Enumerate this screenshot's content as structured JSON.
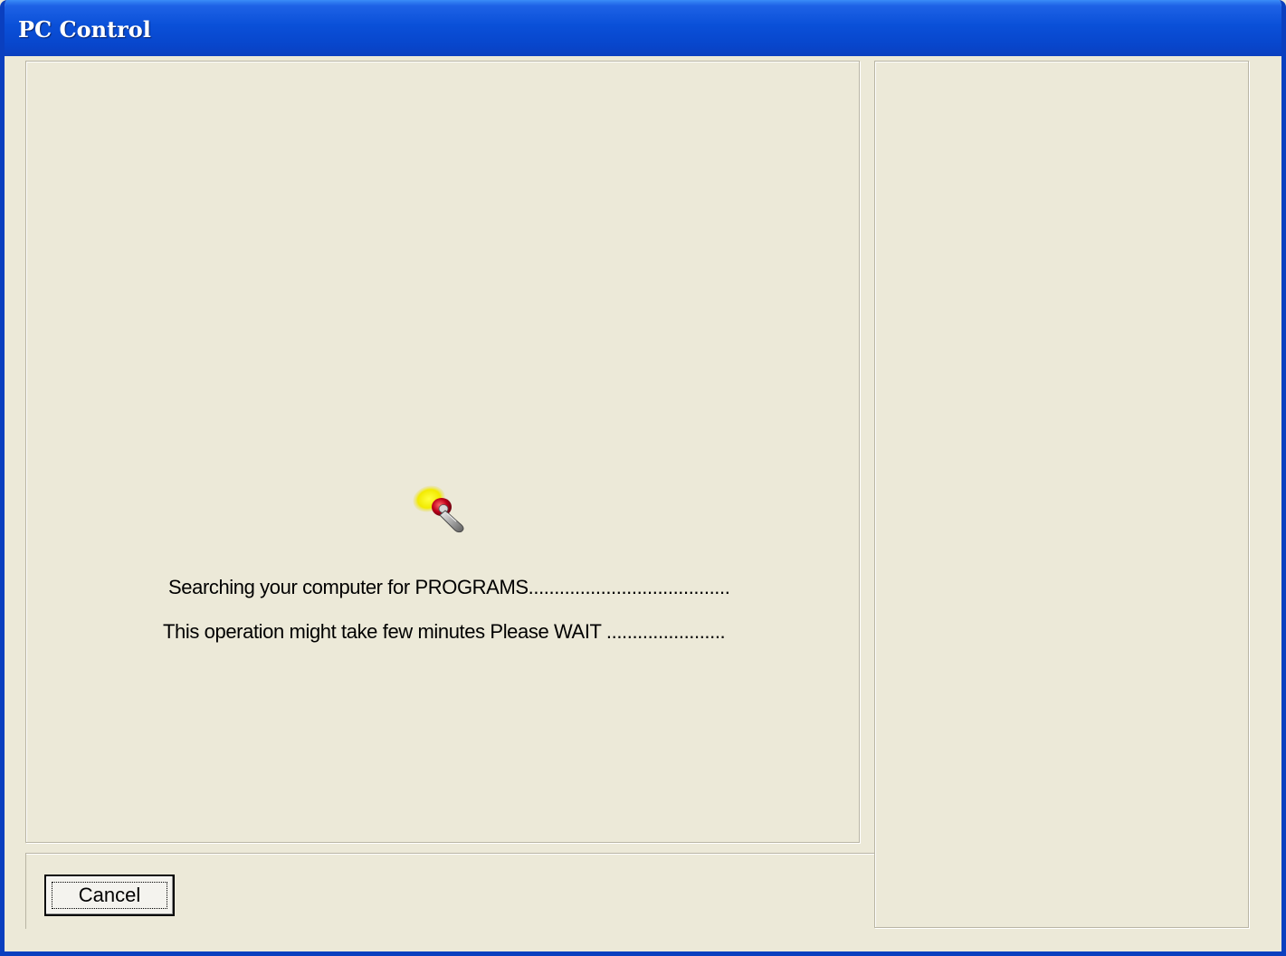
{
  "window": {
    "title": "PC Control"
  },
  "main": {
    "status_line_1": "Searching your computer for PROGRAMS.......................................",
    "status_line_2": "This operation might take few minutes Please WAIT ......................."
  },
  "footer": {
    "cancel_label": "Cancel"
  },
  "icons": {
    "search_indicator": "search-flashlight-icon"
  },
  "colors": {
    "titlebar": "#0a50d8",
    "window_bg": "#ece9d8",
    "frame": "#0a3fbf"
  }
}
